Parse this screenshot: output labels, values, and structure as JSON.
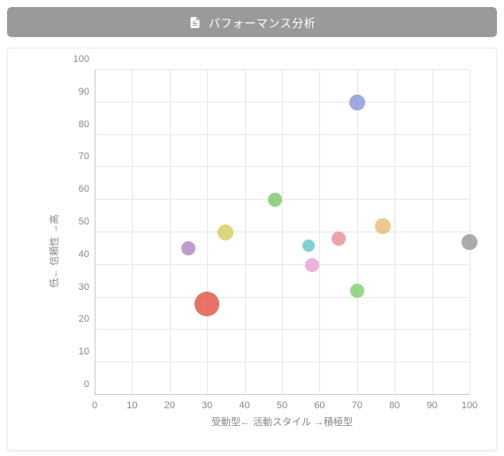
{
  "header": {
    "title": "パフォーマンス分析"
  },
  "chart_data": {
    "type": "scatter",
    "xlabel": "受動型← 活動スタイル →積極型",
    "ylabel": "低← 信頼性 →高",
    "xlim": [
      0,
      100
    ],
    "ylim": [
      0,
      100
    ],
    "x_ticks": [
      0,
      10,
      20,
      30,
      40,
      50,
      60,
      70,
      80,
      90,
      100
    ],
    "y_ticks": [
      0,
      10,
      20,
      30,
      40,
      50,
      60,
      70,
      80,
      90,
      100
    ],
    "points": [
      {
        "x": 30,
        "y": 28,
        "r": 14,
        "color": "#e05a4b"
      },
      {
        "x": 25,
        "y": 45,
        "r": 8,
        "color": "#b589c9"
      },
      {
        "x": 35,
        "y": 50,
        "r": 9,
        "color": "#d6d064"
      },
      {
        "x": 48,
        "y": 60,
        "r": 8,
        "color": "#82c970"
      },
      {
        "x": 57,
        "y": 46,
        "r": 7,
        "color": "#6ec8c8"
      },
      {
        "x": 58,
        "y": 40,
        "r": 8,
        "color": "#e9a6d4"
      },
      {
        "x": 65,
        "y": 48,
        "r": 8,
        "color": "#ec9199"
      },
      {
        "x": 70,
        "y": 32,
        "r": 8,
        "color": "#88cf76"
      },
      {
        "x": 70,
        "y": 90,
        "r": 9,
        "color": "#8f9bd8"
      },
      {
        "x": 77,
        "y": 52,
        "r": 9,
        "color": "#e9c07f"
      },
      {
        "x": 100,
        "y": 47,
        "r": 9,
        "color": "#9c9c9c"
      }
    ]
  }
}
